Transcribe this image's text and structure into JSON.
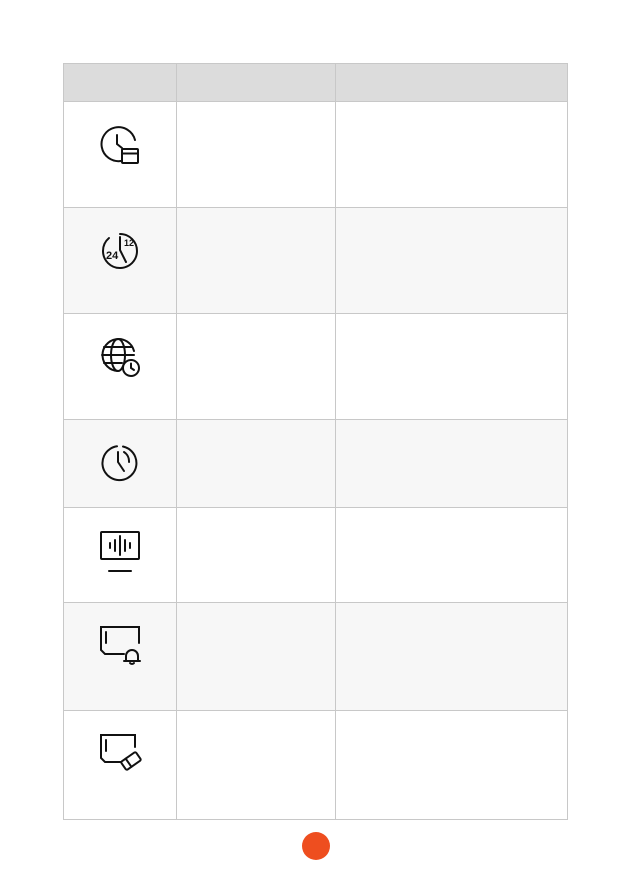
{
  "table": {
    "headers": [
      "",
      "",
      ""
    ],
    "rows": [
      {
        "icon": "clock-calendar-icon",
        "name": "",
        "description": ""
      },
      {
        "icon": "clock-24-12-icon",
        "name": "",
        "description": ""
      },
      {
        "icon": "globe-clock-icon",
        "name": "",
        "description": ""
      },
      {
        "icon": "clock-sync-icon",
        "name": "",
        "description": ""
      },
      {
        "icon": "monitor-sound-wave-icon",
        "name": "",
        "description": ""
      },
      {
        "icon": "screen-bell-icon",
        "name": "",
        "description": ""
      },
      {
        "icon": "screen-eraser-icon",
        "name": "",
        "description": ""
      }
    ]
  },
  "colors": {
    "header_bg": "#dcdcdc",
    "row_alt_bg": "#f7f7f7",
    "border": "#c8c8c8",
    "page_dot": "#ee4e1f"
  }
}
